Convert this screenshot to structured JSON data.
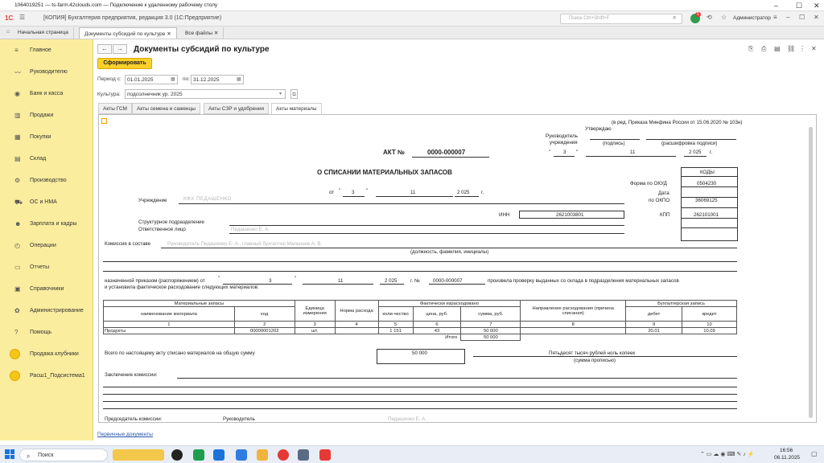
{
  "rdp": {
    "title": "1064019251 — ts-farm.42clouds.com — Подключение к удаленному рабочему столу",
    "minimize": "–",
    "maximize": "☐",
    "close": "✕"
  },
  "app": {
    "logo": "1С",
    "title": "[КОПИЯ] Бухгалтерия предприятия, редакция 3.0  (1С:Предприятие)",
    "search_placeholder": "Поиск Ctrl+Shift+F",
    "user": "Администратор",
    "badge": "5"
  },
  "tabs": [
    {
      "label": "Начальная страница"
    },
    {
      "label": "Документы субсидий по культуре"
    },
    {
      "label": "Все файлы"
    }
  ],
  "sidebar": [
    {
      "label": "Главное",
      "icon": "menu-icon"
    },
    {
      "label": "Руководителю",
      "icon": "chart-icon"
    },
    {
      "label": "Банк и касса",
      "icon": "bank-icon"
    },
    {
      "label": "Продажи",
      "icon": "cart-icon"
    },
    {
      "label": "Покупки",
      "icon": "basket-icon"
    },
    {
      "label": "Склад",
      "icon": "warehouse-icon"
    },
    {
      "label": "Производство",
      "icon": "factory-icon"
    },
    {
      "label": "ОС и НМА",
      "icon": "truck-icon"
    },
    {
      "label": "Зарплата и кадры",
      "icon": "people-icon"
    },
    {
      "label": "Операции",
      "icon": "operations-icon"
    },
    {
      "label": "Отчеты",
      "icon": "reports-icon"
    },
    {
      "label": "Справочники",
      "icon": "book-icon"
    },
    {
      "label": "Администрирование",
      "icon": "gear-icon"
    },
    {
      "label": "Помощь",
      "icon": "help-icon"
    },
    {
      "label": "Продажа клубники",
      "icon": "circle-icon"
    },
    {
      "label": "Расш1_Подсистема1",
      "icon": "circle-icon"
    }
  ],
  "doc": {
    "title": "Документы субсидий по культуре",
    "generate_button": "Сформировать",
    "period_from_label": "Период с:",
    "period_from": "01.01.2025",
    "period_to_label": "по:",
    "period_to": "31.12.2025",
    "culture_label": "Культура:",
    "culture": "подсолнечник ур. 2025",
    "tabs": [
      "Акты ГСМ",
      "Акты семена и саженцы",
      "Акты СЗР и удобрения",
      "Акты материалы"
    ],
    "footer_link": "Первичные документы"
  },
  "form": {
    "edition": "(в ред. Приказа Минфина России от 15.06.2020 № 103н)",
    "approved": "Утверждаю",
    "head_of": "Руководитель\nучреждения",
    "signature_caption": "(подпись)",
    "decode_caption": "(расшифровка подписи)",
    "act_label": "АКТ №",
    "act_number": "0000-000007",
    "sign_day": "3",
    "sign_month": "11",
    "sign_year": "2 025",
    "year_suffix": "г.",
    "title": "О СПИСАНИИ МАТЕРИАЛЬНЫХ ЗАПАСОВ",
    "codes_header": "КОДЫ",
    "okud_label": "Форма по ОКУД",
    "okud": "0504230",
    "date_label": "Дата",
    "okpo_label": "по ОКПО",
    "okpo": "36069125",
    "from_label": "от",
    "act_day": "3",
    "act_month": "11",
    "act_year": "2 025",
    "institution_label": "Учреждение",
    "institution": "КФХ ПЕДАШЕНКО",
    "inn_label": "ИНН",
    "inn": "2621003801",
    "kpp_label": "КПП",
    "kpp": "262101001",
    "division_label": "Структурное подразделение",
    "responsible_label": "Ответственное лицо",
    "responsible": "Педашенко Е. А.",
    "commission_label": "Комиссия в составе",
    "commission": "Руководитель Педашенко Е. А., главный бухгалтер Малышев А. В.",
    "commission_caption": "(должность, фамилия, инициалы)",
    "order_text1": "назначенной приказом (распоряжением) от",
    "order_day": "3",
    "order_month": "11",
    "order_year": "2 025",
    "order_no_label": "г.   №",
    "order_number": "0000-000007",
    "order_text2": "произвела проверку выданных со склада в подразделения материальных запасов",
    "order_text3": "и установила фактическое расходование следующих материалов:",
    "table": {
      "h_materials": "Материальные запасы",
      "h_name": "наименование материала",
      "h_code": "код",
      "h_unit": "Единица измерения",
      "h_norm": "Норма расхода",
      "h_fact": "Фактически израсходовано",
      "h_qty": "коли-чество",
      "h_price": "цена, руб.",
      "h_sum": "сумма, руб.",
      "h_direction": "Направление расходования (причина списания)",
      "h_account": "Бухгалтерская запись",
      "h_debit": "дебет",
      "h_credit": "кредит",
      "nums": [
        "1",
        "2",
        "3",
        "4",
        "5",
        "6",
        "7",
        "8",
        "9",
        "10"
      ],
      "row": {
        "name": "Продукты",
        "code": "00000001202",
        "unit": "шт.",
        "norm": "",
        "qty": "1 151",
        "price": "43",
        "sum": "50 000",
        "direction": "",
        "debit": "20.01",
        "credit": "10.09"
      },
      "total_label": "Итого",
      "total": "50 000"
    },
    "total_text": "Всего по настоящему акту списано материалов на общую сумму",
    "total_value": "50 000",
    "total_words": "Пятьдесят тысяч рублей ноль копеек",
    "total_words_caption": "(сумма прописью)",
    "conclusion_label": "Заключение комиссии:",
    "chairman_label": "Председатель комиссии:",
    "chairman_role": "Руководитель",
    "chairman_name": "Педашенко Е. А."
  },
  "taskbar": {
    "search": "Поиск",
    "time": "16:56",
    "date": "06.11.2025"
  }
}
